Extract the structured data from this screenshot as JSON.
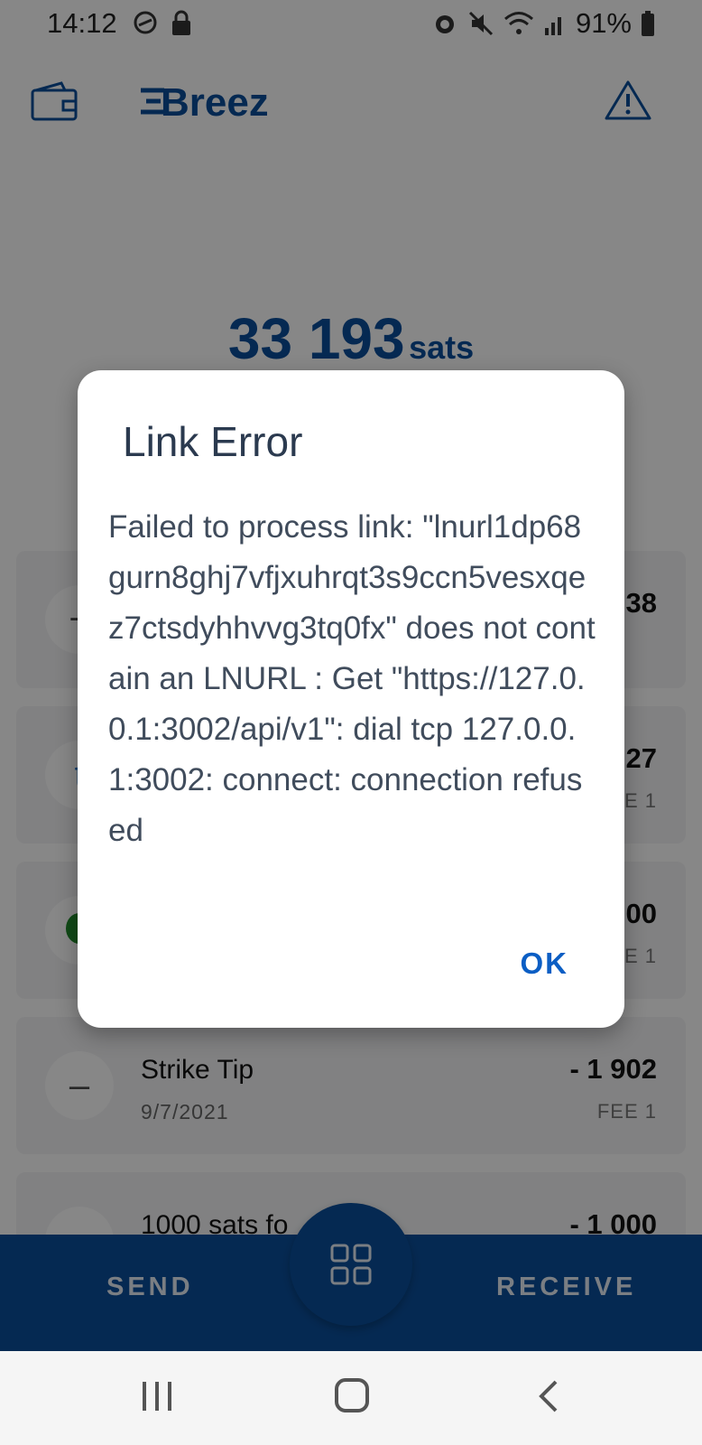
{
  "status_bar": {
    "time": "14:12",
    "battery": "91%"
  },
  "header": {
    "logo_text": "Breez"
  },
  "balance": {
    "amount": "33 193",
    "unit": "sats"
  },
  "transactions": [
    {
      "title": "",
      "date": "",
      "amount": "38",
      "fee": "",
      "icon": "plus-icon"
    },
    {
      "title": "",
      "date": "",
      "amount": "27",
      "fee": "E 1",
      "icon": "tippin-icon"
    },
    {
      "title": "",
      "date": "",
      "amount": "00",
      "fee": "E 1",
      "icon": "alien-icon"
    },
    {
      "title": "Strike Tip",
      "date": "9/7/2021",
      "amount": "- 1 902",
      "fee": "FEE 1",
      "icon": "minus-icon"
    },
    {
      "title": "1000 sats fo",
      "date": "",
      "amount": "- 1 000",
      "fee": "",
      "icon": "minus-icon"
    }
  ],
  "bottom_bar": {
    "send_label": "SEND",
    "receive_label": "RECEIVE"
  },
  "dialog": {
    "title": "Link Error",
    "message": "Failed to process link: \"lnurl1dp68gurn8ghj7vfjxuhrqt3s9ccn5vesxqez7ctsdyhhvvg3tq0fx\" does not contain an LNURL : Get \"https://127.0.0.1:3002/api/v1\": dial tcp 127.0.0.1:3002: connect: connection refused",
    "ok_label": "OK"
  },
  "colors": {
    "brand": "#0b4f9c",
    "dialog_button": "#0b5ec4"
  }
}
